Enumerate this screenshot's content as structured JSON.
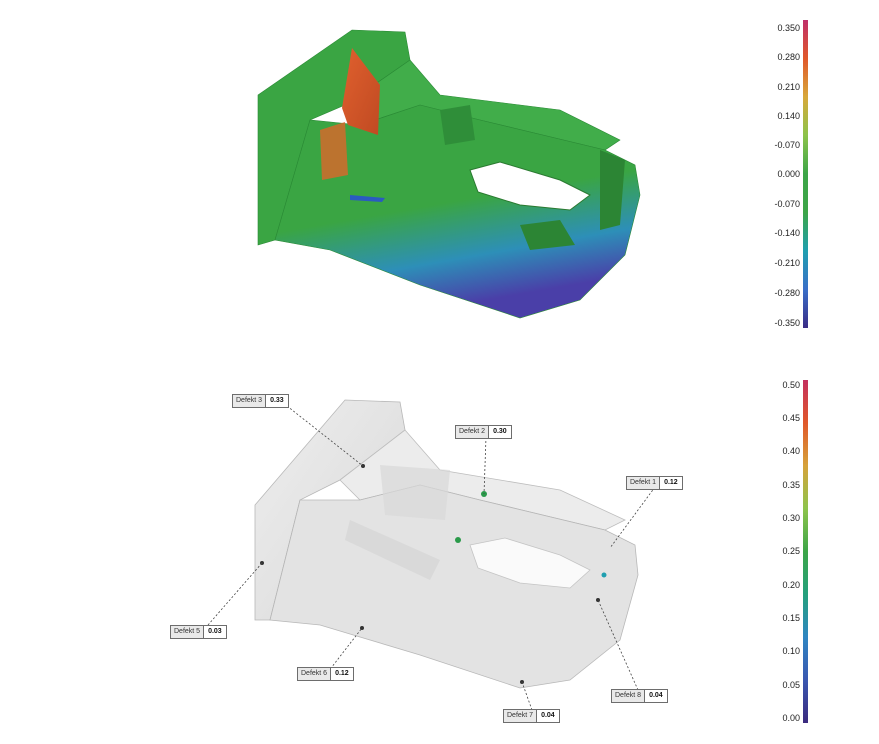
{
  "colors": {
    "deviation_gradient": [
      "#bf2f6a",
      "#e0582a",
      "#d8a83a",
      "#8cc34a",
      "#3ca548",
      "#3ca548",
      "#1f9fb0",
      "#3a6fc8",
      "#3a2c86"
    ],
    "porosity_gradient": [
      "#c4305f",
      "#e0582a",
      "#d6a23a",
      "#8ec44c",
      "#3ca548",
      "#24a07c",
      "#2f86c2",
      "#3a57b0",
      "#3b2a7e"
    ],
    "part_green": "#3aa543",
    "part_grey": "#e6e6e6"
  },
  "deviation_scale": {
    "ticks": [
      "0.350",
      "0.280",
      "0.210",
      "0.140",
      "-0.070",
      "0.000",
      "-0.070",
      "-0.140",
      "-0.210",
      "-0.280",
      "-0.350"
    ]
  },
  "porosity_scale": {
    "ticks": [
      "0.50",
      "0.45",
      "0.40",
      "0.35",
      "0.30",
      "0.25",
      "0.20",
      "0.15",
      "0.10",
      "0.05",
      "0.00"
    ]
  },
  "defects": [
    {
      "label": "Defekt 3",
      "value": "0.33"
    },
    {
      "label": "Defekt 2",
      "value": "0.30"
    },
    {
      "label": "Defekt 1",
      "value": "0.12"
    },
    {
      "label": "Defekt 5",
      "value": "0.03"
    },
    {
      "label": "Defekt 6",
      "value": "0.12"
    },
    {
      "label": "Defekt 8",
      "value": "0.04"
    },
    {
      "label": "Defekt 7",
      "value": "0.04"
    }
  ]
}
